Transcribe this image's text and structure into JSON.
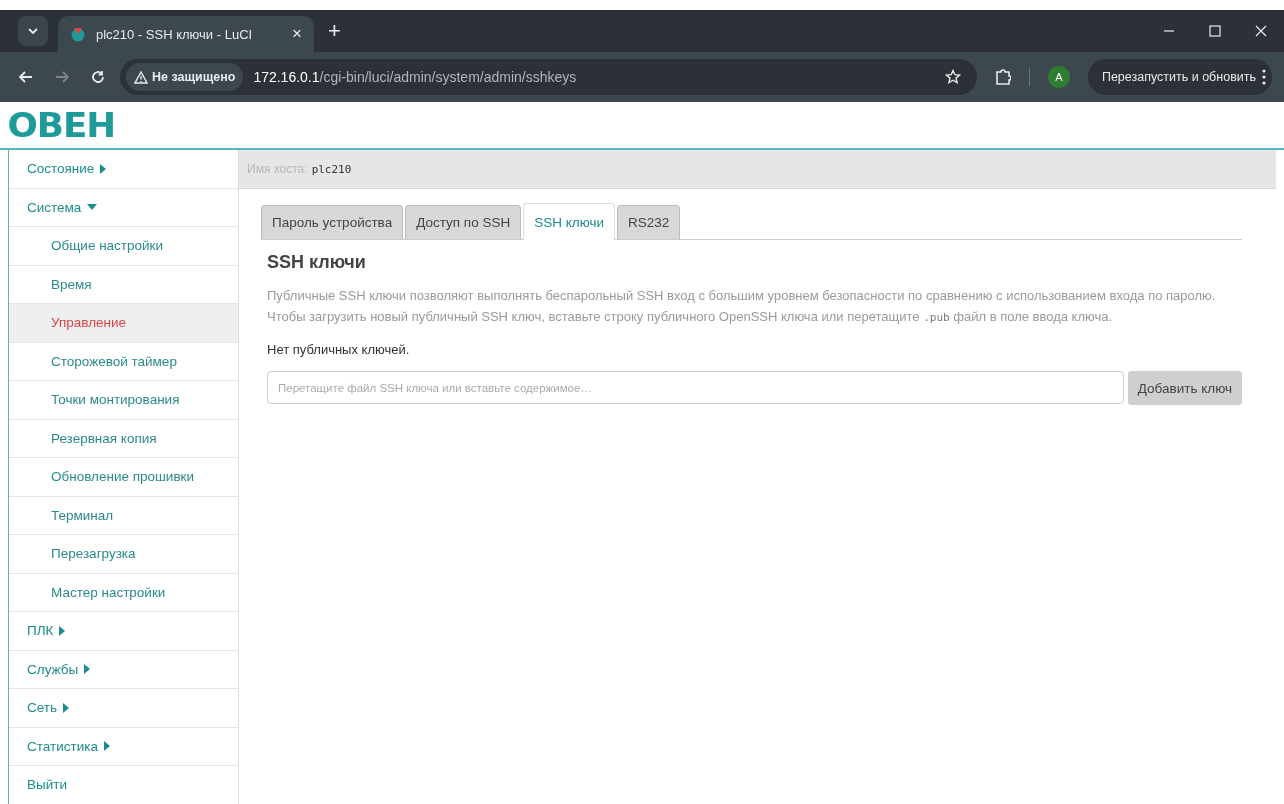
{
  "browser": {
    "tab": {
      "title": "plc210 - SSH ключи - LuCI",
      "close": "×"
    },
    "new_tab": "+",
    "security": "Не защищено",
    "url_host": "172.16.0.1",
    "url_path": "/cgi-bin/luci/admin/system/admin/sshkeys",
    "avatar": "A",
    "update_button": "Перезапустить и обновить"
  },
  "logo": "ОВЕН",
  "sidebar": [
    {
      "label": "Состояние",
      "kind": "menu",
      "expanded": false
    },
    {
      "label": "Система",
      "kind": "menu",
      "expanded": true,
      "children": [
        {
          "label": "Общие настройки",
          "selected": false
        },
        {
          "label": "Время",
          "selected": false
        },
        {
          "label": "Управление",
          "selected": true
        },
        {
          "label": "Сторожевой таймер",
          "selected": false
        },
        {
          "label": "Точки монтирования",
          "selected": false
        },
        {
          "label": "Резервная копия",
          "selected": false
        },
        {
          "label": "Обновление прошивки",
          "selected": false
        },
        {
          "label": "Терминал",
          "selected": false
        },
        {
          "label": "Перезагрузка",
          "selected": false
        },
        {
          "label": "Мастер настройки",
          "selected": false
        }
      ]
    },
    {
      "label": "ПЛК",
      "kind": "menu",
      "expanded": false
    },
    {
      "label": "Службы",
      "kind": "menu",
      "expanded": false
    },
    {
      "label": "Сеть",
      "kind": "menu",
      "expanded": false
    },
    {
      "label": "Статистика",
      "kind": "menu",
      "expanded": false
    },
    {
      "label": "Выйти",
      "kind": "link"
    }
  ],
  "hostname": {
    "label": "Имя хоста:",
    "value": "plc210"
  },
  "tabs": [
    {
      "label": "Пароль устройства",
      "selected": false
    },
    {
      "label": "Доступ по SSH",
      "selected": false
    },
    {
      "label": "SSH ключи",
      "selected": true
    },
    {
      "label": "RS232",
      "selected": false
    }
  ],
  "heading": "SSH ключи",
  "description": {
    "before": "Публичные SSH ключи позволяют выполнять беспарольный SSH вход с большим уровнем безопасности по сравнению с использованием входа по паролю. Чтобы загрузить новый публичный SSH ключ, вставьте строку публичного OpenSSH ключа или перетащите ",
    "code": ".pub",
    "after": " файл в поле ввода ключа."
  },
  "empty_note": "Нет публичных ключей.",
  "key_field": {
    "placeholder": "Перетащите файл SSH ключа или вставьте содержимое…"
  },
  "add_button": "Добавить ключ"
}
